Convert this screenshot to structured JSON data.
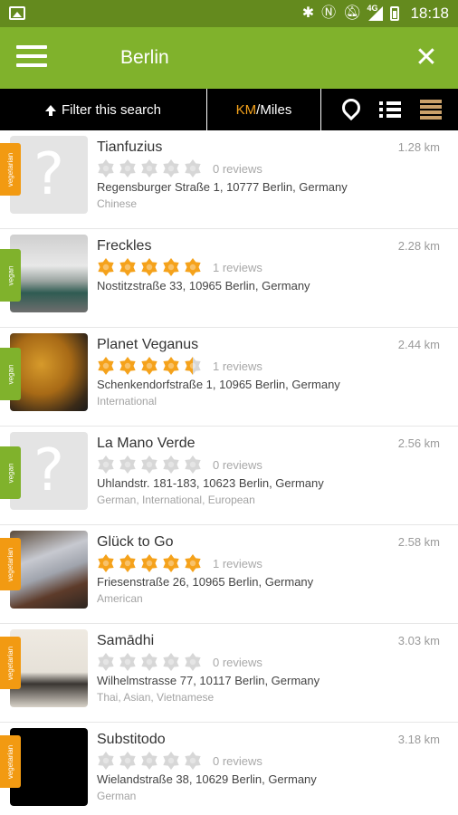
{
  "status_bar": {
    "time": "18:18",
    "network": "4G",
    "icons": [
      "image-icon",
      "bluetooth-icon",
      "nfc-icon",
      "mute-icon",
      "signal-icon",
      "battery-icon"
    ]
  },
  "app_bar": {
    "title": "Berlin",
    "menu_icon": "hamburger-menu-icon",
    "close_icon": "close-icon"
  },
  "toolbar": {
    "filter_label": "Filter this search",
    "units_km": "KM",
    "units_separator": "/",
    "units_miles": "Miles",
    "accent_color": "#f5a21b",
    "icons": [
      "map-pin-icon",
      "list-view-icon",
      "detailed-list-icon"
    ]
  },
  "colors": {
    "app_bar": "#80b22c",
    "status_bar": "#648a1e",
    "vegetarian_tag": "#f29a12",
    "vegan_tag": "#80b22c",
    "star_filled": "#f5a21b",
    "star_empty": "#d7d7d7"
  },
  "restaurants": [
    {
      "name": "Tianfuzius",
      "distance": "1.28 km",
      "tag": "vegetarian",
      "rating": 0,
      "reviews": "0 reviews",
      "address": "Regensburger Straße 1, 10777 Berlin, Germany",
      "cuisine": "Chinese",
      "image": "placeholder"
    },
    {
      "name": "Freckles",
      "distance": "2.28 km",
      "tag": "vegan",
      "rating": 5,
      "reviews": "1 reviews",
      "address": "Nostitzstraße 33, 10965 Berlin, Germany",
      "cuisine": "",
      "image": "photo-a"
    },
    {
      "name": "Planet Veganus",
      "distance": "2.44 km",
      "tag": "vegan",
      "rating": 4.5,
      "reviews": "1 reviews",
      "address": "Schenkendorfstraße 1, 10965 Berlin, Germany",
      "cuisine": "International",
      "image": "photo-b"
    },
    {
      "name": "La Mano Verde",
      "distance": "2.56 km",
      "tag": "vegan",
      "rating": 0,
      "reviews": "0 reviews",
      "address": "Uhlandstr. 181-183, 10623 Berlin, Germany",
      "cuisine": "German, International, European",
      "image": "placeholder"
    },
    {
      "name": "Glück to Go",
      "distance": "2.58 km",
      "tag": "vegetarian",
      "rating": 5,
      "reviews": "1 reviews",
      "address": "Friesenstraße 26, 10965 Berlin, Germany",
      "cuisine": "American",
      "image": "photo-c"
    },
    {
      "name": "Samādhi",
      "distance": "3.03 km",
      "tag": "vegetarian",
      "rating": 0,
      "reviews": "0 reviews",
      "address": "Wilhelmstrasse 77, 10117 Berlin, Germany",
      "cuisine": "Thai, Asian, Vietnamese",
      "image": "photo-d"
    },
    {
      "name": "Substitodo",
      "distance": "3.18 km",
      "tag": "vegetarian",
      "rating": 0,
      "reviews": "0 reviews",
      "address": "Wielandstraße 38, 10629 Berlin, Germany",
      "cuisine": "German",
      "image": "photo-e"
    }
  ]
}
